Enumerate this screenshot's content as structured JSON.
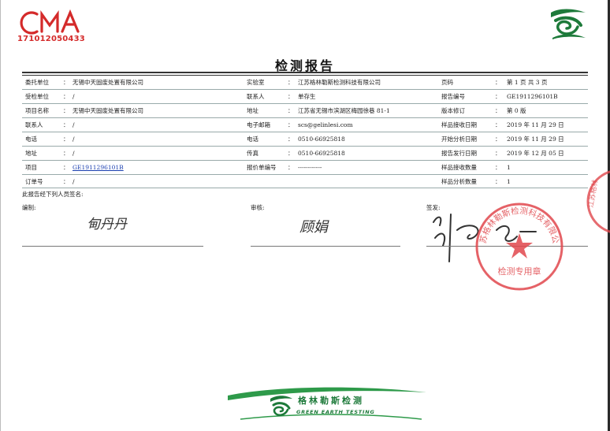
{
  "header": {
    "cma_logo_text": "CMA",
    "cma_number": "171012050433",
    "title": "检测报告"
  },
  "rows": [
    {
      "l1": "委托单位",
      "v1": "无锡中天固废处置有限公司",
      "l2": "实验室",
      "v2": "江苏格林勒斯检测科技有限公司",
      "l3": "页码",
      "v3": "第 1 页 共 3 页"
    },
    {
      "l1": "受检单位",
      "v1": "/",
      "l2": "联系人",
      "v2": "单存生",
      "l3": "报告编号",
      "v3": "GE1911296101B"
    },
    {
      "l1": "项目名称",
      "v1": "无锡中天固废处置有限公司",
      "l2": "地址",
      "v2": "江苏省无锡市滨湖区梅园徐巷 81-1",
      "l3": "版本修订",
      "v3": "第 0 版"
    },
    {
      "l1": "联系人",
      "v1": "/",
      "l2": "电子邮箱",
      "v2": "scs@gelinlesi.com",
      "l3": "样品接收日期",
      "v3": "2019 年 11 月 29 日"
    },
    {
      "l1": "电话",
      "v1": "/",
      "l2": "电话",
      "v2": "0510-66925818",
      "l3": "开始分析日期",
      "v3": "2019 年 11 月 29 日"
    },
    {
      "l1": "地址",
      "v1": "/",
      "l2": "传真",
      "v2": "0510-66925818",
      "l3": "报告发行日期",
      "v3": "2019 年 12 月 05 日"
    },
    {
      "l1": "项目",
      "v1": "GE1911296101B",
      "l2": "报价单编号",
      "v2": "------------",
      "l3": "样品接收数量",
      "v3": "1"
    },
    {
      "l1": "订单号",
      "v1": "/",
      "l2": "",
      "v2": "",
      "l3": "样品分析数量",
      "v3": "1"
    }
  ],
  "colon": "：",
  "signatures": {
    "note": "此报告经下列人员签名:",
    "compiler_label": "编制:",
    "compiler_sig": "甸丹丹",
    "reviewer_label": "审核:",
    "reviewer_sig": "顾娟",
    "signer_label": "签发:"
  },
  "stamp": {
    "text_top": "江苏格林勒斯检测科技有限公司",
    "text_bottom": "检测专用章",
    "side_text": "江苏格林"
  },
  "footer": {
    "company_cn": "格林勒斯检测",
    "company_en": "GREEN EARTH TESTING"
  },
  "colors": {
    "brand_green": "#1d7a3a",
    "stamp_red": "#e0474c",
    "cma_red": "#d42a2a",
    "link_blue": "#1a3fb0"
  }
}
